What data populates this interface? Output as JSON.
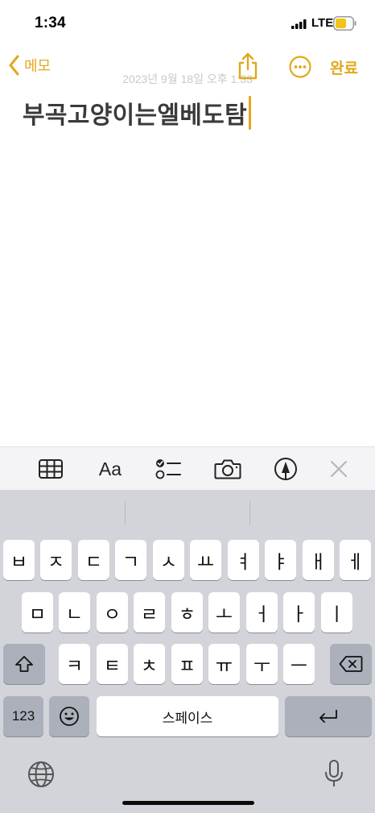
{
  "status": {
    "time": "1:34",
    "network": "LTE"
  },
  "nav": {
    "back_label": "메모",
    "done_label": "완료"
  },
  "note": {
    "date": "2023년 9월 18일 오후 1:33",
    "text": "부곡고양이는엘베도탐"
  },
  "toolbar": {
    "icons": [
      "table-icon",
      "format-icon",
      "checklist-icon",
      "camera-icon",
      "markup-icon",
      "close-icon"
    ],
    "format_label": "Aa"
  },
  "keyboard": {
    "row1": [
      "ㅂ",
      "ㅈ",
      "ㄷ",
      "ㄱ",
      "ㅅ",
      "ㅛ",
      "ㅕ",
      "ㅑ",
      "ㅐ",
      "ㅔ"
    ],
    "row2": [
      "ㅁ",
      "ㄴ",
      "ㅇ",
      "ㄹ",
      "ㅎ",
      "ㅗ",
      "ㅓ",
      "ㅏ",
      "ㅣ"
    ],
    "row3": [
      "ㅋ",
      "ㅌ",
      "ㅊ",
      "ㅍ",
      "ㅠ",
      "ㅜ",
      "ㅡ"
    ],
    "numbers_label": "123",
    "space_label": "스페이스"
  },
  "colors": {
    "accent": "#e2a81c",
    "keyboard_bg": "#d2d4da",
    "key_dark": "#abb0bb"
  }
}
